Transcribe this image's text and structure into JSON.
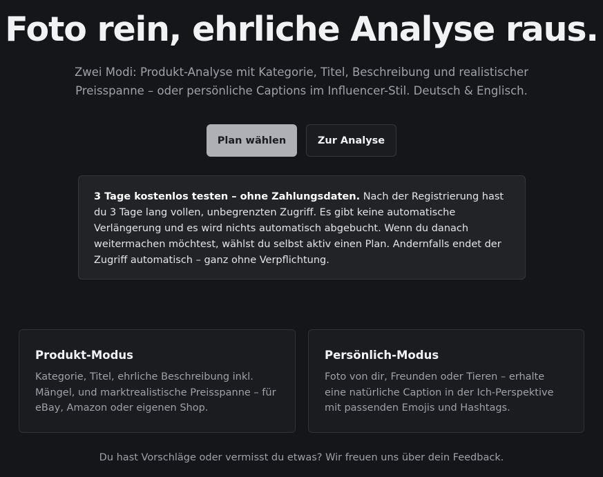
{
  "hero": {
    "title": "Foto rein, ehrliche Analyse raus.",
    "subtitle": "Zwei Modi: Produkt-Analyse mit Kategorie, Titel, Beschreibung und realistischer Preisspanne – oder persönliche Captions im Influencer-Stil. Deutsch & Englisch."
  },
  "actions": {
    "primary_label": "Plan wählen",
    "secondary_label": "Zur Analyse"
  },
  "trial": {
    "headline": "3 Tage kostenlos testen – ohne Zahlungsdaten.",
    "body": " Nach der Registrierung hast du 3 Tage lang vollen, unbegrenzten Zugriff. Es gibt keine automatische Verlängerung und es wird nichts automatisch abgebucht. Wenn du danach weitermachen möchtest, wählst du selbst aktiv einen Plan. Andernfalls endet der Zugriff automatisch – ganz ohne Verpflichtung."
  },
  "modes": [
    {
      "title": "Produkt-Modus",
      "description": "Kategorie, Titel, ehrliche Beschreibung inkl. Mängel, und marktrealistische Preisspanne – für eBay, Amazon oder eigenen Shop."
    },
    {
      "title": "Persönlich-Modus",
      "description": "Foto von dir, Freunden oder Tieren – erhalte eine natürliche Caption in der Ich-Perspektive mit passenden Emojis und Hashtags."
    }
  ],
  "footer": {
    "feedback_text": "Du hast Vorschläge oder vermisst du etwas? Wir freuen uns über dein Feedback."
  }
}
